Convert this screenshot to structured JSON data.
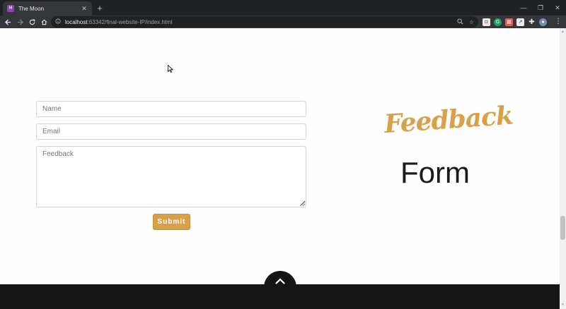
{
  "browser": {
    "tab_title": "The Moon",
    "tab_favicon_text": "M",
    "url_host": "localhost",
    "url_path": ":63342/final-website-IP/index.html",
    "icons": [
      "back-icon",
      "forward-icon",
      "reload-icon",
      "home-icon",
      "info-icon",
      "zoom-icon",
      "star-icon",
      "extensions-icon",
      "menu-icon"
    ]
  },
  "form": {
    "name_placeholder": "Name",
    "email_placeholder": "Email",
    "feedback_placeholder": "Feedback",
    "submit_label": "Submit"
  },
  "heading": {
    "script_text": "Feedback",
    "main_text": "Form"
  },
  "colors": {
    "accent": "#d9a04a",
    "footer": "#151515",
    "heading": "#1b1b1b"
  }
}
